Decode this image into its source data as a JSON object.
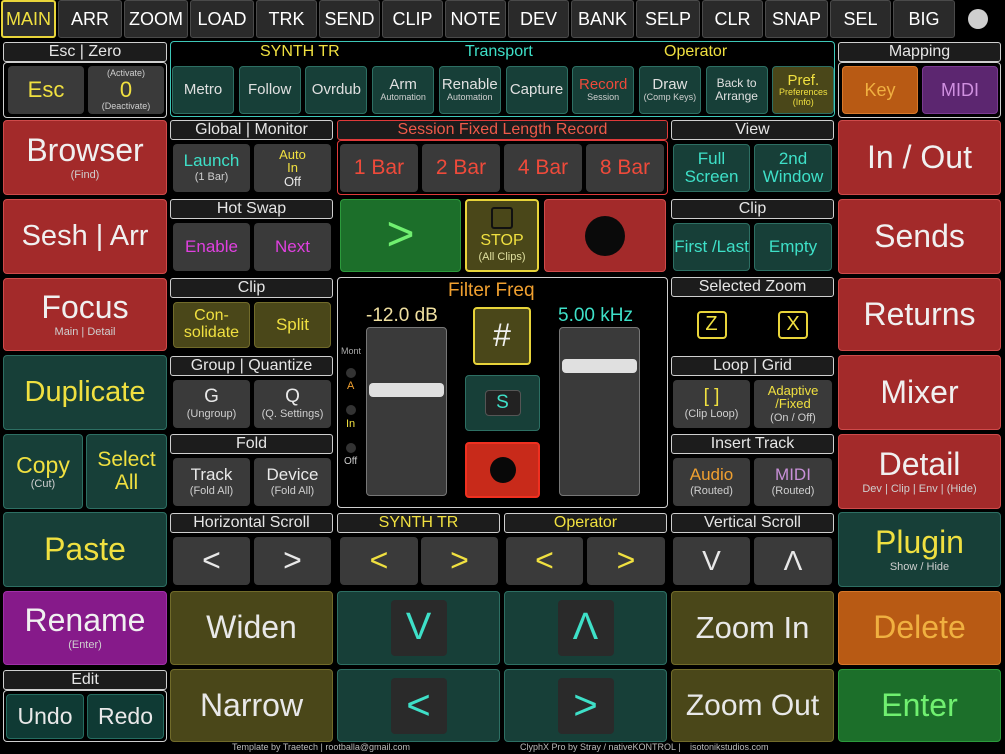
{
  "tabs": [
    "MAIN",
    "ARR",
    "ZOOM",
    "LOAD",
    "TRK",
    "SEND",
    "CLIP",
    "NOTE",
    "DEV",
    "BANK",
    "SELP",
    "CLR",
    "SNAP",
    "SEL",
    "BIG"
  ],
  "left": {
    "esc_header": "Esc   |   Zero",
    "esc": "Esc",
    "zero": "0",
    "zero_top": "(Activate)",
    "zero_bot": "(Deactivate)",
    "browser": "Browser",
    "browser_sub": "(Find)",
    "sesh": "Sesh | Arr",
    "focus": "Focus",
    "focus_sub": "Main | Detail",
    "duplicate": "Duplicate",
    "copy": "Copy",
    "copy_sub": "(Cut)",
    "select": "Select All",
    "paste": "Paste",
    "rename": "Rename",
    "rename_sub": "(Enter)",
    "edit_header": "Edit",
    "undo": "Undo",
    "redo": "Redo"
  },
  "transport": {
    "synth": "SYNTH TR",
    "title": "Transport",
    "operator": "Operator",
    "buttons": [
      {
        "label": "Metro",
        "sub": ""
      },
      {
        "label": "Follow",
        "sub": ""
      },
      {
        "label": "Ovrdub",
        "sub": ""
      },
      {
        "label": "Arm",
        "sub": "Automation"
      },
      {
        "label": "Renable",
        "sub": "Automation"
      },
      {
        "label": "Capture",
        "sub": ""
      },
      {
        "label": "Record",
        "sub": "Session"
      },
      {
        "label": "Draw",
        "sub": "(Comp Keys)"
      },
      {
        "label": "Back to Arrange",
        "sub": ""
      },
      {
        "label": "Pref.",
        "sub": "Preferences (Info)"
      }
    ]
  },
  "mapping": {
    "header": "Mapping",
    "key": "Key",
    "midi": "MIDI"
  },
  "global": {
    "header": "Global  |  Monitor",
    "launch": "Launch",
    "launch_sub": "(1 Bar)",
    "auto": "Auto",
    "auto2": "In",
    "auto3": "Off"
  },
  "session": {
    "header": "Session Fixed Length Record",
    "bars": [
      "1 Bar",
      "2 Bar",
      "4 Bar",
      "8 Bar"
    ]
  },
  "view": {
    "header": "View",
    "full": "Full Screen",
    "second": "2nd Window"
  },
  "right": {
    "inout": "In / Out",
    "sends": "Sends",
    "returns": "Returns",
    "mixer": "Mixer",
    "detail": "Detail",
    "detail_sub": "Dev | Clip | Env | (Hide)",
    "plugin": "Plugin",
    "plugin_sub": "Show / Hide",
    "delete": "Delete",
    "enter": "Enter"
  },
  "hotswap": {
    "header": "Hot Swap",
    "enable": "Enable",
    "next": "Next"
  },
  "play": {
    "play": ">",
    "stop": "STOP",
    "stop_sub": "(All Clips)"
  },
  "clip_r": {
    "header": "Clip",
    "first": "First /Last",
    "empty": "Empty"
  },
  "clip_l": {
    "header": "Clip",
    "consolidate": "Con- solidate",
    "split": "Split"
  },
  "filter": {
    "title": "Filter Freq",
    "db": "-12.0 dB",
    "khz": "5.00 kHz",
    "hash": "#",
    "s": "S",
    "mont": "Mont",
    "a": "A",
    "in": "In",
    "off": "Off"
  },
  "selzoom": {
    "header": "Selected Zoom",
    "z": "Z",
    "x": "X"
  },
  "group": {
    "header": "Group  | Quantize",
    "g": "G",
    "g_sub": "(Ungroup)",
    "q": "Q",
    "q_sub": "(Q. Settings)"
  },
  "loop": {
    "header": "Loop     |    Grid",
    "loop": "[ ]",
    "loop_sub": "(Clip Loop)",
    "adaptive": "Adaptive /Fixed",
    "adaptive_sub": "(On / Off)"
  },
  "fold": {
    "header": "Fold",
    "track": "Track",
    "track_sub": "(Fold All)",
    "device": "Device",
    "device_sub": "(Fold All)"
  },
  "insert": {
    "header": "Insert Track",
    "audio": "Audio",
    "audio_sub": "(Routed)",
    "midi": "MIDI",
    "midi_sub": "(Routed)"
  },
  "hscroll": {
    "header": "Horizontal Scroll",
    "l": "<",
    "r": ">"
  },
  "synth2": {
    "header": "SYNTH TR",
    "l": "<",
    "r": ">"
  },
  "oper2": {
    "header": "Operator",
    "l": "<",
    "r": ">"
  },
  "vscroll": {
    "header": "Vertical Scroll",
    "d": "V",
    "u": "Λ"
  },
  "bottom": {
    "widen": "Widen",
    "narrow": "Narrow",
    "down": "V",
    "up": "Λ",
    "left": "<",
    "right": ">",
    "zoomin": "Zoom In",
    "zoomout": "Zoom Out"
  },
  "footer": {
    "a": "Template by Traetech | rootballa@gmail.com",
    "b": "ClyphX Pro by Stray / nativeKONTROL |",
    "c": "isotonikstudios.com"
  },
  "colors": {
    "teal": "#3ec7b8",
    "yellow": "#f0e040",
    "red": "#e03a3a"
  }
}
